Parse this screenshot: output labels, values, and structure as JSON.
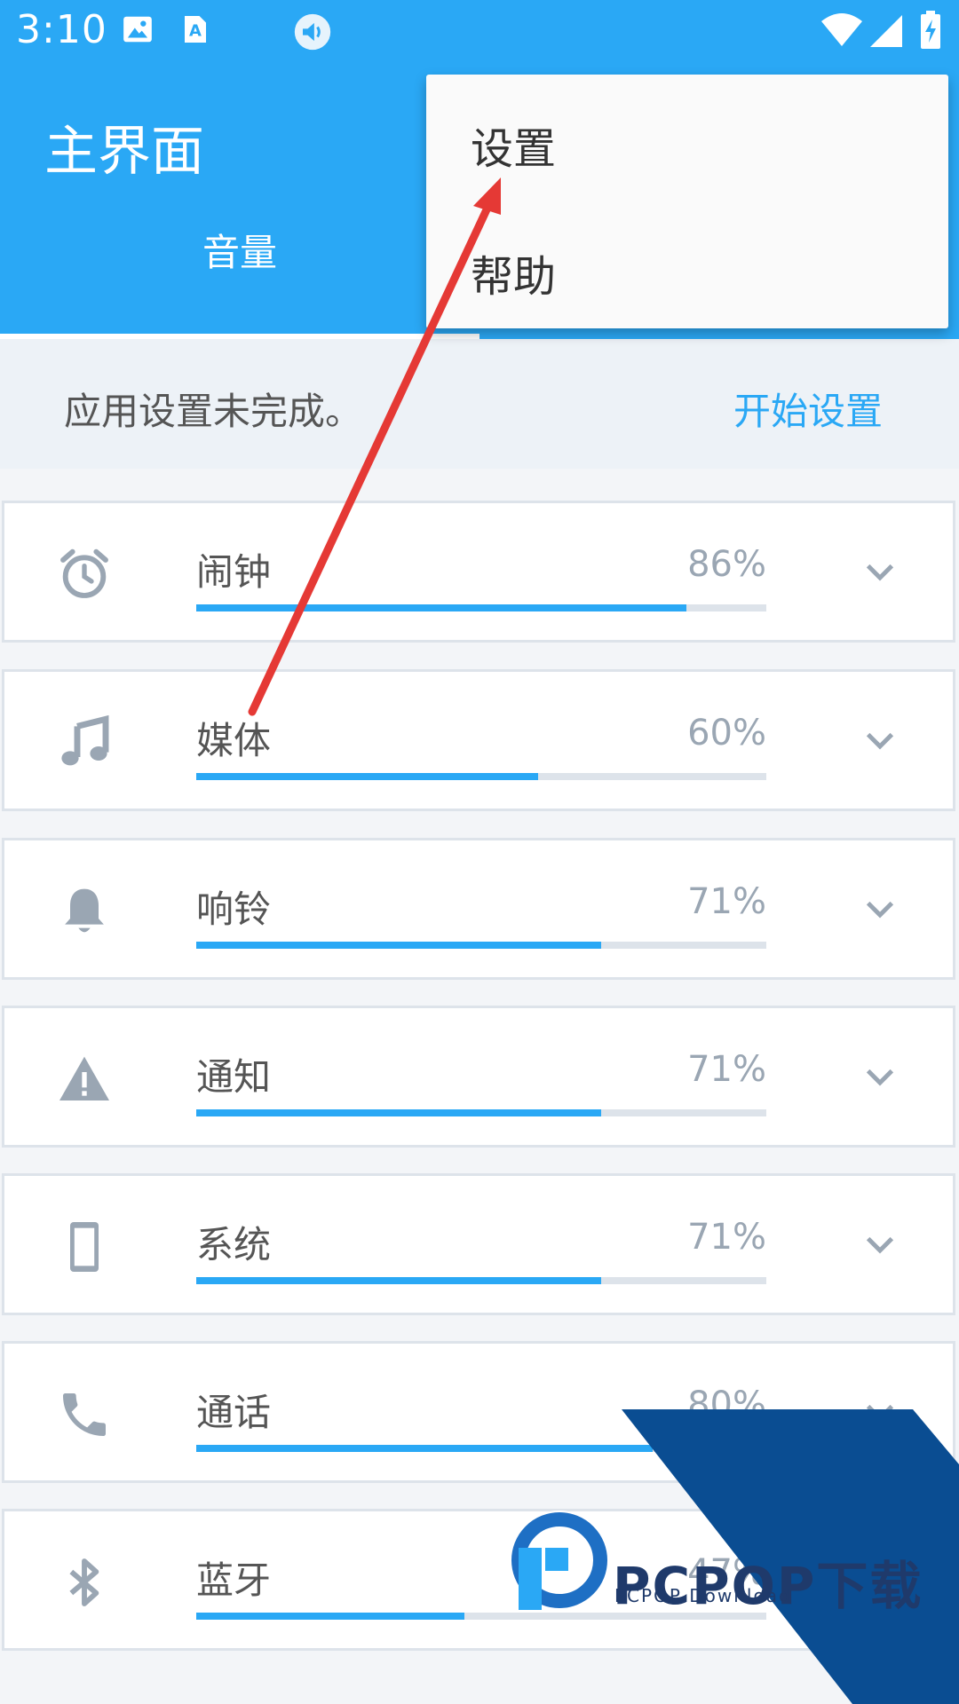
{
  "status_bar": {
    "time": "3:10"
  },
  "app_bar": {
    "title": "主界面",
    "tabs": [
      {
        "label": "音量",
        "active": true
      }
    ]
  },
  "menu": {
    "items": [
      {
        "label": "设置"
      },
      {
        "label": "帮助"
      }
    ]
  },
  "banner": {
    "message": "应用设置未完成。",
    "action": "开始设置"
  },
  "volume_items": [
    {
      "label": "闹钟",
      "percent_text": "86%",
      "level": 0.86,
      "icon": "alarm-icon"
    },
    {
      "label": "媒体",
      "percent_text": "60%",
      "level": 0.6,
      "icon": "music-note-icon"
    },
    {
      "label": "响铃",
      "percent_text": "71%",
      "level": 0.71,
      "icon": "bell-icon"
    },
    {
      "label": "通知",
      "percent_text": "71%",
      "level": 0.71,
      "icon": "warning-icon"
    },
    {
      "label": "系统",
      "percent_text": "71%",
      "level": 0.71,
      "icon": "phone-device-icon"
    },
    {
      "label": "通话",
      "percent_text": "80%",
      "level": 0.8,
      "icon": "phone-call-icon"
    },
    {
      "label": "蓝牙",
      "percent_text": "47%",
      "level": 0.47,
      "icon": "bluetooth-icon"
    }
  ],
  "watermark": {
    "brand": "PCPOP下载",
    "sub": "PCPOP Download"
  },
  "colors": {
    "primary": "#2aa8f5",
    "annotation": "#e53935",
    "watermark": "#0a4d92"
  }
}
